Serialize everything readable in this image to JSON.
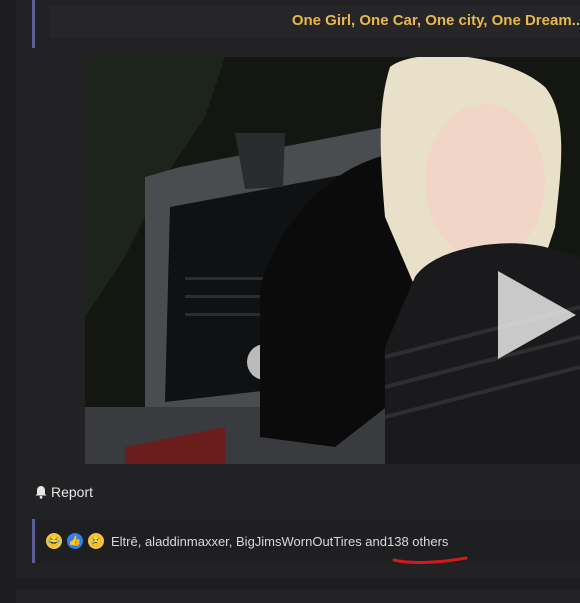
{
  "post": {
    "headline": "One Girl, One Car, One city, One Dream..",
    "media": {
      "type": "video",
      "play_icon": "play-icon"
    },
    "report_label": "Report",
    "report_icon": "bell-icon"
  },
  "reactions": {
    "icons": [
      "laughing-crying-emoji-icon",
      "thumbs-up-icon",
      "sad-face-emoji-icon"
    ],
    "names_text": "Eltrē, aladdinmaxxer, BigJimsWornOutTires and ",
    "others_text": "138 others"
  },
  "colors": {
    "headline": "#e8b84a",
    "quote_bar": "#5a5f9a",
    "annotation": "#d11b1b"
  }
}
